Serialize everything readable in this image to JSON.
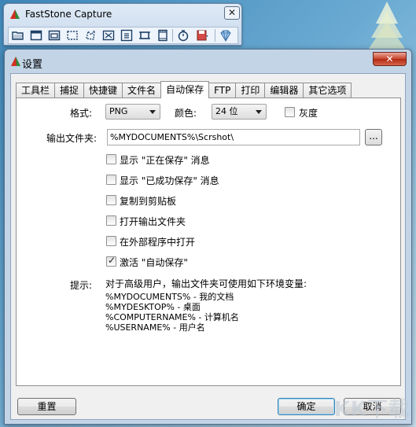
{
  "faststone": {
    "title": "FastStone Capture",
    "close_label": "✕",
    "tools": [
      {
        "icon": "open-folder-icon"
      },
      {
        "icon": "capture-active-window-icon"
      },
      {
        "icon": "capture-window-object-icon"
      },
      {
        "icon": "capture-rectangle-icon"
      },
      {
        "icon": "capture-freehand-icon"
      },
      {
        "icon": "capture-fullscreen-icon"
      },
      {
        "icon": "capture-scrolling-icon"
      },
      {
        "icon": "capture-fixed-region-icon"
      },
      {
        "icon": "screen-recorder-icon"
      },
      {
        "icon": "delay-timer-icon"
      },
      {
        "icon": "output-destination-icon"
      },
      {
        "icon": "settings-menu-icon"
      }
    ]
  },
  "dialog": {
    "title": "设置",
    "close_label": "✕",
    "tabs": [
      "工具栏",
      "捕捉",
      "快捷键",
      "文件名",
      "自动保存",
      "FTP",
      "打印",
      "编辑器",
      "其它选项"
    ],
    "active_tab": 4,
    "format_label": "格式:",
    "format_value": "PNG",
    "color_label": "颜色:",
    "color_value": "24 位",
    "grayscale_label": "灰度",
    "output_folder_label": "输出文件夹:",
    "output_folder_value": "%MYDOCUMENTS%\\Scrshot\\",
    "browse_label": "...",
    "options": [
      {
        "label": "显示 \"正在保存\" 消息",
        "checked": false
      },
      {
        "label": "显示 \"已成功保存\" 消息",
        "checked": false
      },
      {
        "label": "复制到剪贴板",
        "checked": false
      },
      {
        "label": "打开输出文件夹",
        "checked": false
      },
      {
        "label": "在外部程序中打开",
        "checked": false
      },
      {
        "label": "激活 \"自动保存\"",
        "checked": true
      }
    ],
    "hint_label": "提示:",
    "hint_lines": [
      "对于高级用户，输出文件夹可使用如下环境变量:",
      "%MYDOCUMENTS%   -   我的文档",
      "%MYDESKTOP%   -   桌面",
      "%COMPUTERNAME%   -   计算机名",
      "%USERNAME%   -   用户名"
    ],
    "reset_label": "重置",
    "ok_label": "确定",
    "cancel_label": "取消"
  },
  "watermark": "KK下载"
}
